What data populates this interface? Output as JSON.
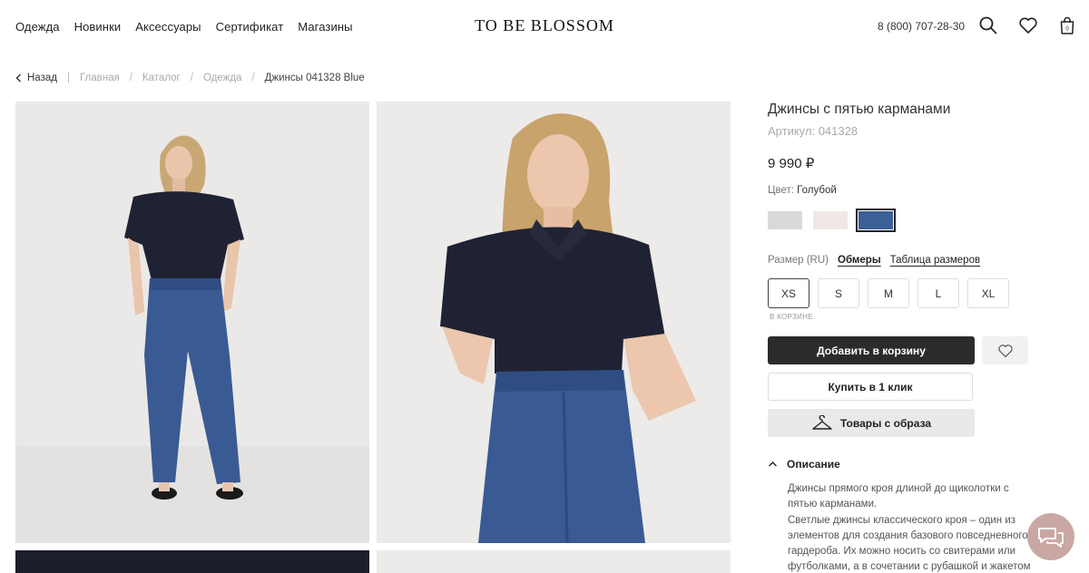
{
  "nav": {
    "items": [
      "Одежда",
      "Новинки",
      "Аксессуары",
      "Сертификат",
      "Магазины"
    ]
  },
  "logo": "TO BE BLOSSOM",
  "header": {
    "phone": "8 (800) 707-28-30",
    "cart_count": "0",
    "icons": [
      "search-icon",
      "heart-icon",
      "bag-icon"
    ]
  },
  "breadcrumb": {
    "back": "Назад",
    "items": [
      "Главная",
      "Каталог",
      "Одежда"
    ],
    "current": "Джинсы 041328 Blue"
  },
  "product": {
    "title": "Джинсы с пятью карманами",
    "sku": "Артикул: 041328",
    "price": "9 990 ₽",
    "color_label": "Цвет:",
    "color_value": "Голубой",
    "swatches": [
      "#d9d9d9",
      "#efe8e7",
      "#3c5f95"
    ],
    "selected_swatch": 2,
    "size_label": "Размер (RU)",
    "measurements_link": "Обмеры",
    "size_table_link": "Таблица размеров",
    "sizes": [
      "XS",
      "S",
      "M",
      "L",
      "XL"
    ],
    "selected_size": "XS",
    "in_cart_note": "В КОРЗИНЕ",
    "add_to_cart": "Добавить в корзину",
    "buy_one_click": "Купить в 1 клик",
    "look_items": "Товары с образа",
    "description_title": "Описание",
    "description_p1": "Джинсы прямого кроя длиной до щиколотки с пятью карманами.",
    "description_p2": "Светлые джинсы классического кроя – один из элементов для создания базового повседневного гардероба. Их можно носить со свитерами или футболками, а в сочетании с рубашкой и жакетом"
  },
  "colors": {
    "shirt": "#1f2233",
    "denim": "#3a5a93",
    "backdrop": "#ebe9e7",
    "chat_bubble": "#c9a8a4"
  }
}
